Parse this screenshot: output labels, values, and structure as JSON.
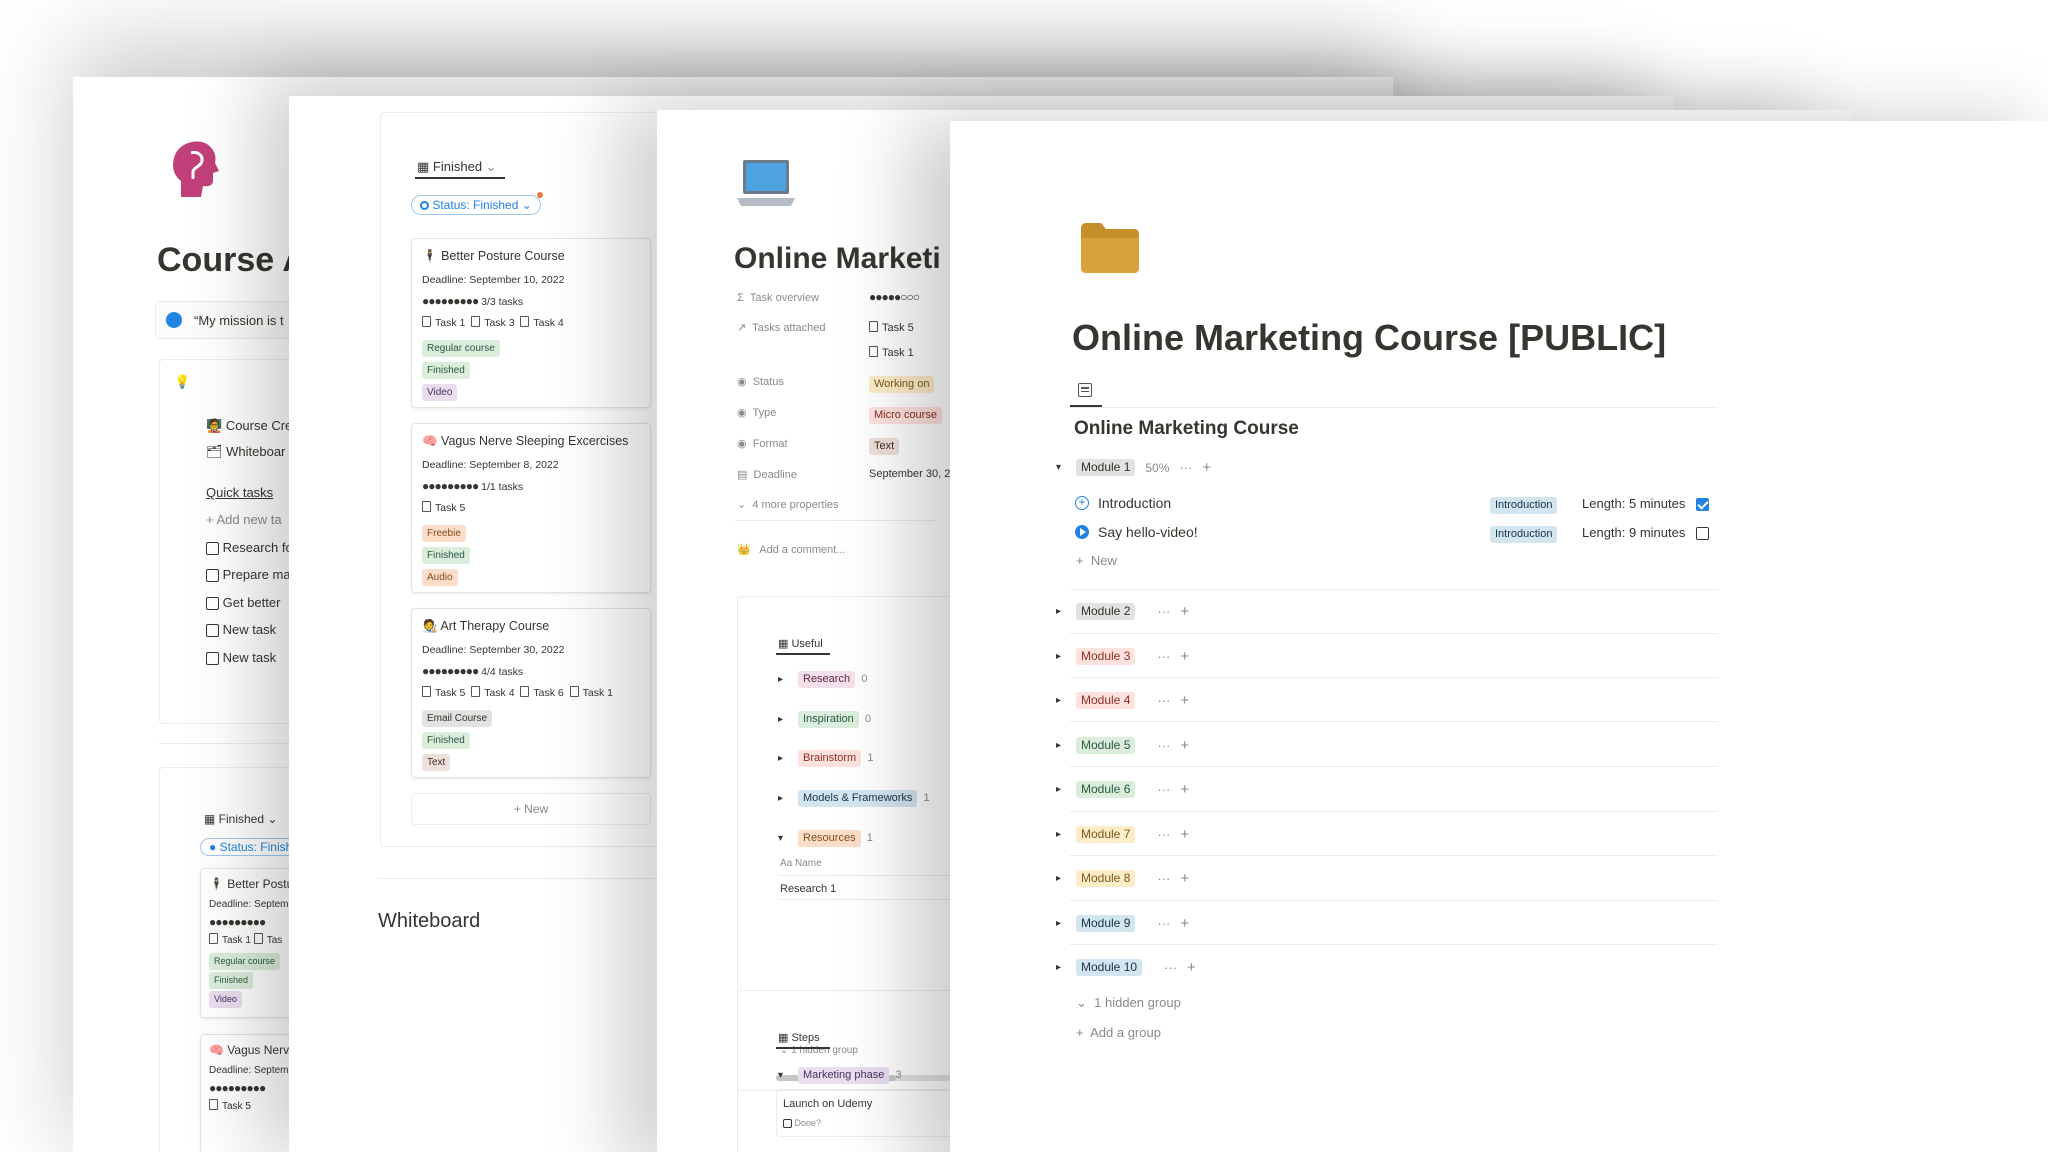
{
  "page1": {
    "title": "Course A",
    "quote": "“My mission is t",
    "links": [
      "Course Cre",
      "Whiteboar"
    ],
    "quick_tasks": {
      "heading": "Quick tasks",
      "add": "Add new ta",
      "items": [
        "Research fo",
        "Prepare ma",
        "Get better",
        "New task",
        "New task"
      ]
    },
    "board_view": "Finished",
    "filter": "Status: Finish",
    "cards": [
      {
        "title": "Better Postu",
        "deadline": "Deadline: Septem",
        "tasks": "Task 1",
        "task2": "Tas",
        "tags": [
          "Regular course",
          "Finished",
          "Video"
        ]
      },
      {
        "title": "Vagus Nerv",
        "deadline": "Deadline: Septem",
        "tasks": "Task 5"
      }
    ]
  },
  "page2": {
    "view_name": "Finished",
    "filter": "Status: Finished",
    "cards": [
      {
        "title": "Better Posture Course",
        "deadline": "Deadline: September 10, 2022",
        "progress": "3/3 tasks",
        "tasks": [
          "Task 1",
          "Task 3",
          "Task 4"
        ],
        "tags": [
          "Regular course",
          "Finished",
          "Video"
        ]
      },
      {
        "title": "Vagus Nerve Sleeping Excercises",
        "deadline": "Deadline: September 8, 2022",
        "progress": "1/1 tasks",
        "tasks": [
          "Task 5"
        ],
        "tags": [
          "Freebie",
          "Finished",
          "Audio"
        ]
      },
      {
        "title": "Art Therapy Course",
        "deadline": "Deadline: September 30, 2022",
        "progress": "4/4 tasks",
        "tasks": [
          "Task 5",
          "Task 4",
          "Task 6",
          "Task 1"
        ],
        "tags": [
          "Email Course",
          "Finished",
          "Text"
        ]
      }
    ],
    "new": "New",
    "whiteboard": "Whiteboard"
  },
  "page3": {
    "title": "Online Marketi",
    "properties": [
      {
        "label": "Task overview",
        "value": "●●●●●○○○"
      },
      {
        "label": "Tasks attached",
        "value": "Task 5",
        "value2": "Task 1"
      },
      {
        "label": "Status",
        "value": "Working on"
      },
      {
        "label": "Type",
        "value": "Micro course"
      },
      {
        "label": "Format",
        "value": "Text"
      },
      {
        "label": "Deadline",
        "value": "September 30, 2("
      }
    ],
    "more_props": "4 more properties",
    "add_comment": "Add a comment...",
    "useful": {
      "tab": "Useful",
      "groups": [
        {
          "name": "Research",
          "count": "0"
        },
        {
          "name": "Inspiration",
          "count": "0"
        },
        {
          "name": "Brainstorm",
          "count": "1"
        },
        {
          "name": "Models & Frameworks",
          "count": "1"
        },
        {
          "name": "Resources",
          "count": "1"
        }
      ],
      "name_col": "Name",
      "row": "Research 1",
      "hidden": "1 hidden group"
    },
    "steps": {
      "tab": "Steps",
      "group": "Marketing phase",
      "count": "3",
      "item": "Launch on Udemy",
      "done": "Done?"
    }
  },
  "page4": {
    "title": "Online Marketing Course [PUBLIC]",
    "db_title": "Online Marketing Course",
    "module1": {
      "label": "Module 1",
      "pct": "50%"
    },
    "lessons": [
      {
        "name": "Introduction",
        "tag": "Introduction",
        "length": "Length: 5 minutes",
        "done": true
      },
      {
        "name": "Say hello-video!",
        "tag": "Introduction",
        "length": "Length: 9 minutes",
        "done": false
      }
    ],
    "new": "New",
    "modules": [
      "Module 2",
      "Module 3",
      "Module 4",
      "Module 5",
      "Module 6",
      "Module 7",
      "Module 8",
      "Module 9",
      "Module 10"
    ],
    "hidden_group": "1 hidden group",
    "add_group": "Add a group"
  },
  "colors": {
    "accent_blue": "#2383e2",
    "folder": "#d9a13a",
    "brain": "#c2407a"
  }
}
